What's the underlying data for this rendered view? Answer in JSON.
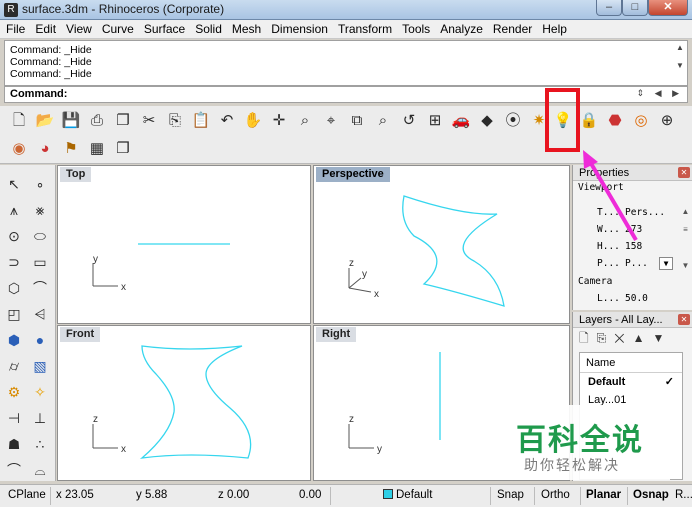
{
  "window": {
    "title": "surface.3dm - Rhinoceros (Corporate)",
    "min_icon": "minimize-icon",
    "max_icon": "maximize-icon",
    "close_icon": "close-icon"
  },
  "menu": [
    "File",
    "Edit",
    "View",
    "Curve",
    "Surface",
    "Solid",
    "Mesh",
    "Dimension",
    "Transform",
    "Tools",
    "Analyze",
    "Render",
    "Help"
  ],
  "command_history": [
    "Command: _Hide",
    "Command: _Hide",
    "Command: _Hide"
  ],
  "command_prompt": "Command:",
  "viewports": {
    "top": "Top",
    "perspective": "Perspective",
    "front": "Front",
    "right": "Right"
  },
  "axes": {
    "top": [
      "y",
      "x"
    ],
    "perspective": [
      "z",
      "y",
      "x"
    ],
    "front": [
      "z",
      "x"
    ],
    "right": [
      "z",
      "y"
    ]
  },
  "properties": {
    "title": "Properties",
    "section_viewport": "Viewport",
    "rows": [
      {
        "key": "T...",
        "value": "Pers..."
      },
      {
        "key": "W...",
        "value": "273"
      },
      {
        "key": "H...",
        "value": "158"
      },
      {
        "key": "P...",
        "value": "P..."
      }
    ],
    "section_camera": "Camera",
    "camera_rows": [
      {
        "key": "L...",
        "value": "50.0"
      }
    ]
  },
  "layers": {
    "title": "Layers - All Lay...",
    "column": "Name",
    "default_layer": "Default",
    "partial_row": "Lay...01"
  },
  "status": {
    "cplane": "CPlane",
    "x": "x 23.05",
    "y": "y 5.88",
    "z": "z 0.00",
    "d": "0.00",
    "layer": "Default",
    "snap": "Snap",
    "ortho": "Ortho",
    "planar": "Planar",
    "osnap": "Osnap",
    "more": "R..."
  },
  "watermark": {
    "title": "百科全说",
    "subtitle": "助你轻松解决"
  },
  "colors": {
    "curve": "#36d6ee",
    "highlight": "#e8141f",
    "arrow": "#ee2bd8"
  }
}
